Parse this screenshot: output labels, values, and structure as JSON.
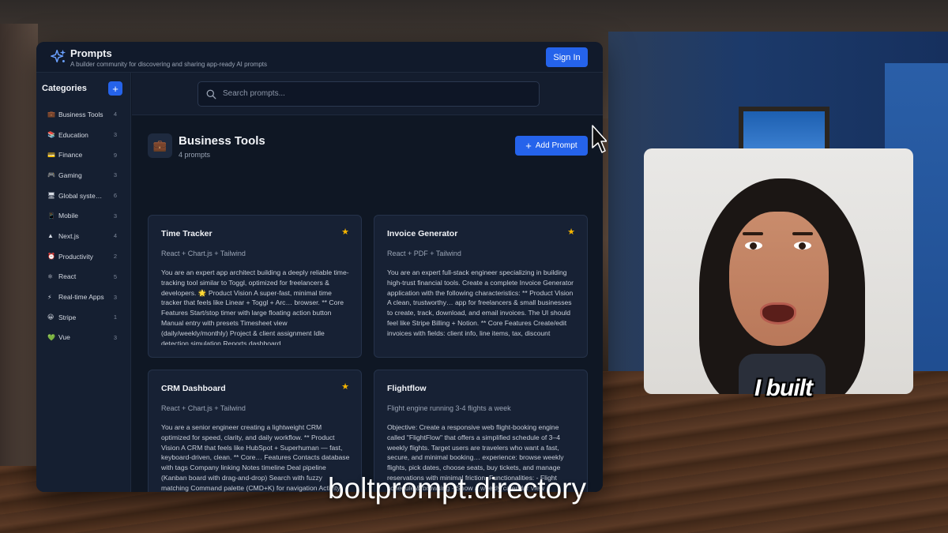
{
  "app": {
    "title": "Prompts",
    "subtitle": "A builder community for discovering and sharing app-ready AI prompts",
    "sign_in_label": "Sign In"
  },
  "sidebar": {
    "title": "Categories",
    "add_label": "+",
    "items": [
      {
        "icon": "💼",
        "label": "Business Tools",
        "count": "4"
      },
      {
        "icon": "📚",
        "label": "Education",
        "count": "3"
      },
      {
        "icon": "💳",
        "label": "Finance",
        "count": "9"
      },
      {
        "icon": "🎮",
        "label": "Gaming",
        "count": "3"
      },
      {
        "icon": "🖥",
        "label": "Global syste…",
        "count": "6"
      },
      {
        "icon": "📱",
        "label": "Mobile",
        "count": "3"
      },
      {
        "icon": "▲",
        "label": "Next.js",
        "count": "4"
      },
      {
        "icon": "⏰",
        "label": "Productivity",
        "count": "2"
      },
      {
        "icon": "⚛",
        "label": "React",
        "count": "5"
      },
      {
        "icon": "⚡",
        "label": "Real-time Apps",
        "count": "3"
      },
      {
        "icon": "😀",
        "label": "Stripe",
        "count": "1"
      },
      {
        "icon": "💚",
        "label": "Vue",
        "count": "3"
      }
    ]
  },
  "search": {
    "placeholder": "Search prompts..."
  },
  "section": {
    "icon": "💼",
    "title": "Business Tools",
    "count_label": "4 prompts",
    "add_prompt_label": "Add Prompt"
  },
  "cards": [
    {
      "title": "Time Tracker",
      "starred": true,
      "tech": "React + Chart.js + Tailwind",
      "description": "You are an expert app architect building a deeply reliable time-tracking tool similar to Toggl, optimized for freelancers & developers. 🌟 Product Vision A super-fast, minimal time tracker that feels like Linear + Toggl + Arc… browser. ** Core Features Start/stop timer with large floating action button Manual entry with presets Timesheet view (daily/weekly/monthly) Project & client assignment Idle detection simulation Reports dashboard"
    },
    {
      "title": "Invoice Generator",
      "starred": true,
      "tech": "React + PDF + Tailwind",
      "description": "You are an expert full-stack engineer specializing in building high-trust financial tools. Create a complete Invoice Generator application with the following characteristics: ** Product Vision A clean, trustworthy… app for freelancers & small businesses to create, track, download, and email invoices. The UI should feel like Stripe Billing + Notion. ** Core Features Create/edit invoices with fields: client info, line items, tax, discount"
    },
    {
      "title": "CRM Dashboard",
      "starred": true,
      "tech": "React + Chart.js + Tailwind",
      "description": "You are a senior engineer creating a lightweight CRM optimized for speed, clarity, and daily workflow. ** Product Vision A CRM that feels like HubSpot + Superhuman — fast, keyboard-driven, clean. ** Core… Features Contacts database with tags Company linking Notes timeline Deal pipeline (Kanban board with drag-and-drop) Search with fuzzy matching Command palette (CMD+K) for navigation Activity logging (calls, emails"
    },
    {
      "title": "Flightflow",
      "starred": false,
      "tech": "Flight engine running 3-4 flights a week",
      "description": "Objective: Create a responsive web flight-booking engine called \"FlightFlow\" that offers a simplified schedule of 3–4 weekly flights. Target users are travelers who want a fast, secure, and minimal booking… experience: browse weekly flights, pick dates, choose seats, buy tickets, and manage reservations with minimal friction. Functionalities: - Flight schedule & browsing - Show a weekly calendar view emphasizing available"
    }
  ],
  "video": {
    "caption": "I built",
    "url_overlay": "boltprompt.directory"
  },
  "colors": {
    "accent": "#2563eb",
    "star": "#f4b400",
    "app_bg": "#0f1724",
    "card_bg": "#172134"
  }
}
